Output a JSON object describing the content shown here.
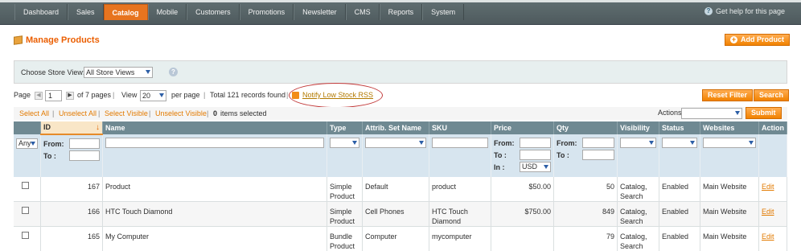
{
  "nav": {
    "items": [
      "Dashboard",
      "Sales",
      "Catalog",
      "Mobile",
      "Customers",
      "Promotions",
      "Newsletter",
      "CMS",
      "Reports",
      "System"
    ],
    "active": "Catalog",
    "help": "Get help for this page"
  },
  "header": {
    "title": "Manage Products",
    "add_button": "Add Product"
  },
  "store": {
    "label": "Choose Store View:",
    "value": "All Store Views"
  },
  "pager": {
    "page_label": "Page",
    "page": "1",
    "of_pages": "of 7 pages",
    "view_label": "View",
    "per_page": "20",
    "per_page_label": "per page",
    "total": "Total 121 records found",
    "rss": "Notify Low Stock RSS",
    "reset": "Reset Filter",
    "search": "Search"
  },
  "mass": {
    "select_all": "Select All",
    "unselect_all": "Unselect All",
    "select_visible": "Select Visible",
    "unselect_visible": "Unselect Visible",
    "selected_count": "0",
    "selected_label": "items selected",
    "actions_label": "Actions",
    "submit": "Submit"
  },
  "columns": [
    "ID",
    "Name",
    "Type",
    "Attrib. Set Name",
    "SKU",
    "Price",
    "Qty",
    "Visibility",
    "Status",
    "Websites",
    "Action"
  ],
  "filter": {
    "any": "Any",
    "from": "From:",
    "to": "To :",
    "in": "In :",
    "currency": "USD"
  },
  "rows": [
    {
      "id": "167",
      "name": "Product",
      "type": "Simple Product",
      "set": "Default",
      "sku": "product",
      "price": "$50.00",
      "qty": "50",
      "visibility": "Catalog, Search",
      "status": "Enabled",
      "website": "Main Website",
      "action": "Edit"
    },
    {
      "id": "166",
      "name": "HTC Touch Diamond",
      "type": "Simple Product",
      "set": "Cell Phones",
      "sku": "HTC Touch Diamond",
      "price": "$750.00",
      "qty": "849",
      "visibility": "Catalog, Search",
      "status": "Enabled",
      "website": "Main Website",
      "action": "Edit"
    },
    {
      "id": "165",
      "name": "My Computer",
      "type": "Bundle Product",
      "set": "Computer",
      "sku": "mycomputer",
      "price": "",
      "qty": "79",
      "visibility": "Catalog, Search",
      "status": "Enabled",
      "website": "Main Website",
      "action": "Edit"
    }
  ]
}
